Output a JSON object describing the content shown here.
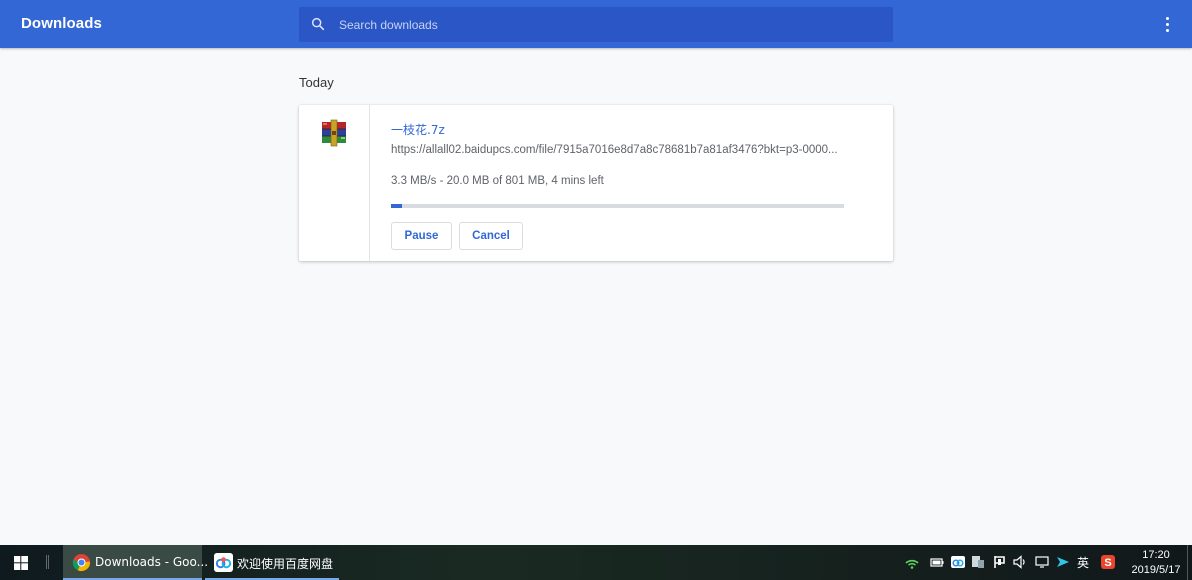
{
  "header": {
    "title": "Downloads",
    "search_placeholder": "Search downloads"
  },
  "section": {
    "date": "Today"
  },
  "download": {
    "file_name": "一枝花.7z",
    "url": "https://allall02.baidupcs.com/file/7915a7016e8d7a8c78681b7a81af3476?bkt=p3-0000...",
    "status": "3.3 MB/s - 20.0 MB of 801 MB, 4 mins left",
    "progress_fraction": 0.025,
    "pause_label": "Pause",
    "cancel_label": "Cancel",
    "icon": "winrar-archive-icon"
  },
  "taskbar": {
    "tasks": [
      {
        "label": "Downloads - Goo...",
        "icon": "chrome-icon"
      },
      {
        "label": "欢迎使用百度网盘",
        "icon": "baidu-netdisk-icon"
      }
    ],
    "ime": "英",
    "time": "17:20",
    "date": "2019/5/17"
  },
  "colors": {
    "header_bg": "#3367d6",
    "search_bg": "#2a56c6",
    "accent": "#3367d6",
    "page_bg": "#f8f9fa"
  }
}
